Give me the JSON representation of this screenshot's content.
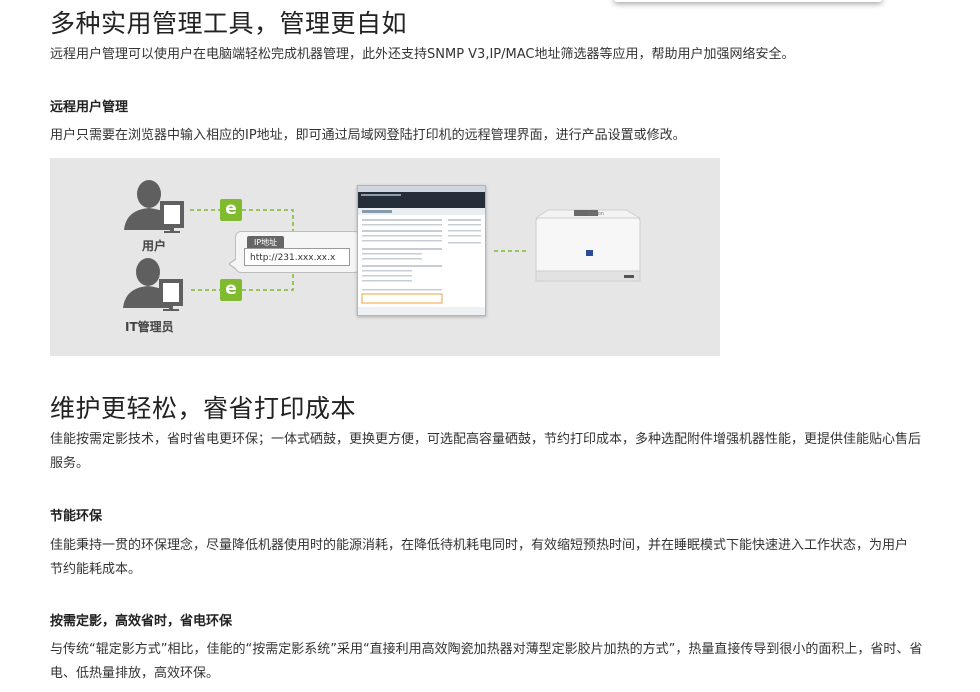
{
  "section1": {
    "title": "多种实用管理工具，管理更自如",
    "intro": "远程用户管理可以使用户在电脑端轻松完成机器管理，此外还支持SNMP V3,IP/MAC地址筛选器等应用，帮助用户加强网络安全。",
    "subheading": "远程用户管理",
    "subtext": "用户只需要在浏览器中输入相应的IP地址，即可通过局域网登陆打印机的远程管理界面，进行产品设置或修改。"
  },
  "figure": {
    "user_label": "用户",
    "admin_label": "IT管理员",
    "ip_tag": "IP地址",
    "ip_url": "http://231.xxx.xx.x",
    "browser_letter": "e",
    "printer_brand": "Canon",
    "colors": {
      "background": "#e6e6e6",
      "accent_green": "#7fba2f",
      "person": "#5f5f5f"
    }
  },
  "section2": {
    "title": "维护更轻松，睿省打印成本",
    "intro": "佳能按需定影技术，省时省电更环保；一体式硒鼓，更换更方便，可选配高容量硒鼓，节约打印成本，多种选配附件增强机器性能，更提供佳能贴心售后服务。",
    "sub1_heading": "节能环保",
    "sub1_text": "佳能秉持一贯的环保理念，尽量降低机器使用时的能源消耗，在降低待机耗电同时，有效缩短预热时间，并在睡眠模式下能快速进入工作状态，为用户节约能耗成本。",
    "sub2_heading": "按需定影，高效省时，省电环保",
    "sub2_text": "与传统“辊定影方式”相比，佳能的“按需定影系统”采用“直接利用高效陶瓷加热器对薄型定影胶片加热的方式”，热量直接传导到很小的面积上，省时、省电、低热量排放，高效环保。"
  }
}
